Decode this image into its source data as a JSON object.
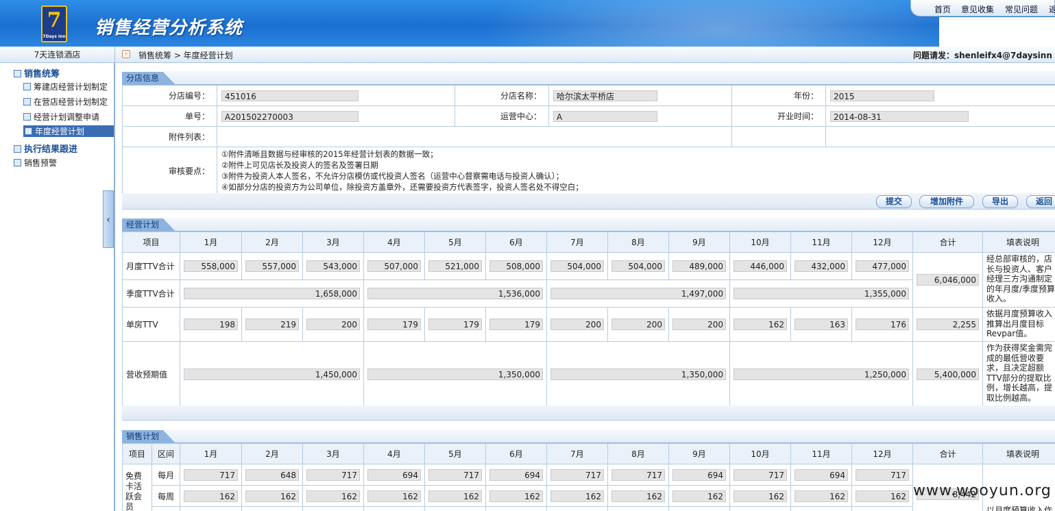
{
  "header": {
    "logo_number": "7",
    "logo_brand": "7Days Inn",
    "system_title": "销售经营分析系统",
    "top_links": [
      "首页",
      "意见收集",
      "常见问题",
      "返"
    ]
  },
  "breadcrumb_bar": {
    "hotel_name": "7天连锁酒店",
    "breadcrumb": "销售统筹 > 年度经营计划",
    "contact": "问题请发：shenleifx4@7daysinn"
  },
  "sidebar": {
    "groups": [
      {
        "label": "销售统筹",
        "items": [
          "筹建店经营计划制定",
          "在营店经营计划制定",
          "经营计划调整申请",
          "年度经营计划"
        ],
        "active": "年度经营计划"
      },
      {
        "label": "执行结果跟进",
        "items": [
          "销售预警"
        ]
      }
    ],
    "collapse_glyph": "‹"
  },
  "branch_info": {
    "section_title": "分店信息",
    "branch_no_label": "分店编号：",
    "branch_no": "451016",
    "branch_name_label": "分店名称：",
    "branch_name": "哈尔滨太平桥店",
    "year_label": "年份：",
    "year": "2015",
    "order_no_label": "单号：",
    "order_no": "A201502270003",
    "ops_center_label": "运营中心：",
    "ops_center": "A",
    "open_date_label": "开业时间：",
    "open_date": "2014-08-31",
    "attachments_label": "附件列表：",
    "review_label": "审核要点：",
    "review_points": [
      "①附件清晰且数据与经审核的2015年经营计划表的数据一致；",
      "②附件上可见店长及投资人的签名及签署日期",
      "③附件为投资人本人签名，不允许分店模仿或代投资人签名（运营中心督察需电话与投资人确认）；",
      "④如部分分店的投资方为公司单位，除投资方盖章外，还需要投资方代表签字，投资人签名处不得空白；"
    ],
    "buttons": [
      "提交",
      "增加附件",
      "导出",
      "返回"
    ]
  },
  "business_plan": {
    "section_title": "经营计划",
    "headers": [
      "项目",
      "1月",
      "2月",
      "3月",
      "4月",
      "5月",
      "6月",
      "7月",
      "8月",
      "9月",
      "10月",
      "11月",
      "12月",
      "合计",
      "填表说明"
    ],
    "monthly_ttv": {
      "label": "月度TTV合计",
      "values": [
        "558,000",
        "557,000",
        "543,000",
        "507,000",
        "521,000",
        "508,000",
        "504,000",
        "504,000",
        "489,000",
        "446,000",
        "432,000",
        "477,000"
      ],
      "total": "6,046,000"
    },
    "quarterly_ttv": {
      "label": "季度TTV合计",
      "values": [
        "1,658,000",
        "1,536,000",
        "1,497,000",
        "1,355,000"
      ]
    },
    "ttv_note": "经总部审核的，店长与投资人、客户经理三方沟通制定的年月度/季度预算收入。",
    "room_ttv": {
      "label": "单房TTV",
      "values": [
        "198",
        "219",
        "200",
        "179",
        "179",
        "179",
        "200",
        "200",
        "200",
        "162",
        "163",
        "176"
      ],
      "total": "2,255",
      "note": "依据月度预算收入推算出月度目标Revpar值。"
    },
    "revenue_expect": {
      "label": "营收预期值",
      "values": [
        "1,450,000",
        "1,350,000",
        "1,350,000",
        "1,250,000"
      ],
      "total": "5,400,000",
      "note": "作为获得奖金需完成的最低营收要求，且决定超额TTV部分的提取比例，增长越高，提取比例越高。"
    }
  },
  "sales_plan": {
    "section_title": "销售计划",
    "headers": [
      "项目",
      "区间",
      "1月",
      "2月",
      "3月",
      "4月",
      "5月",
      "6月",
      "7月",
      "8月",
      "9月",
      "10月",
      "11月",
      "12月",
      "合计",
      "填表说明"
    ],
    "item_label": "免费卡活跃会员",
    "rows": [
      {
        "period": "每月",
        "values": [
          "717",
          "648",
          "717",
          "694",
          "717",
          "694",
          "717",
          "717",
          "694",
          "717",
          "694",
          "717"
        ]
      },
      {
        "period": "每周",
        "values": [
          "162",
          "162",
          "162",
          "162",
          "162",
          "162",
          "162",
          "162",
          "162",
          "162",
          "162",
          "162"
        ]
      }
    ],
    "total_partial": "8,442",
    "note_partial": "以月度预算收入作"
  },
  "watermark": "www.wooyun.org"
}
